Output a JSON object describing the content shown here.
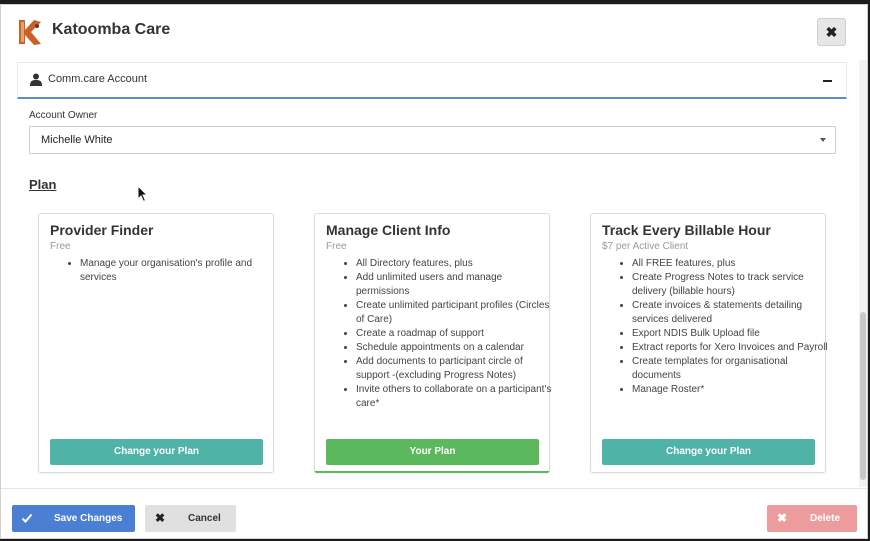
{
  "app": {
    "title": "Katoomba Care",
    "close_icon": "close-icon",
    "logo_icon": "katoomba-k-logo"
  },
  "section": {
    "title": "Comm.care Account",
    "icon": "user-icon",
    "collapse_icon": "minus-icon"
  },
  "account_owner": {
    "label": "Account Owner",
    "value": "Michelle White"
  },
  "plan": {
    "heading": "Plan",
    "cards": [
      {
        "title": "Provider Finder",
        "price": "Free",
        "features": [
          "Manage your organisation's profile and services"
        ],
        "button": "Change your Plan",
        "selected": false
      },
      {
        "title": "Manage Client Info",
        "price": "Free",
        "features": [
          "All Directory features, plus",
          "Add unlimited users and manage permissions",
          "Create unlimited participant profiles (Circles of Care)",
          "Create a roadmap of support",
          "Schedule appointments on a calendar",
          "Add documents to participant circle of support -(excluding Progress Notes)",
          "Invite others to collaborate on a participant's care*"
        ],
        "button": "Your Plan",
        "selected": true
      },
      {
        "title": "Track Every Billable Hour",
        "price": "$7 per Active Client",
        "features": [
          "All FREE features, plus",
          "Create Progress Notes to track service delivery (billable hours)",
          "Create invoices & statements detailing services delivered",
          "Export NDIS Bulk Upload file",
          "Extract reports for Xero Invoices and Payroll",
          "Create templates for organisational documents",
          "Manage Roster*"
        ],
        "button": "Change your Plan",
        "selected": false
      }
    ]
  },
  "footer": {
    "save": "Save Changes",
    "cancel": "Cancel",
    "delete": "Delete"
  },
  "colors": {
    "primary": "#4a7fd4",
    "teal": "#4fb3a8",
    "green": "#5cb85c",
    "danger": "#ec9c9c",
    "accent_line": "#5b8ed1"
  }
}
